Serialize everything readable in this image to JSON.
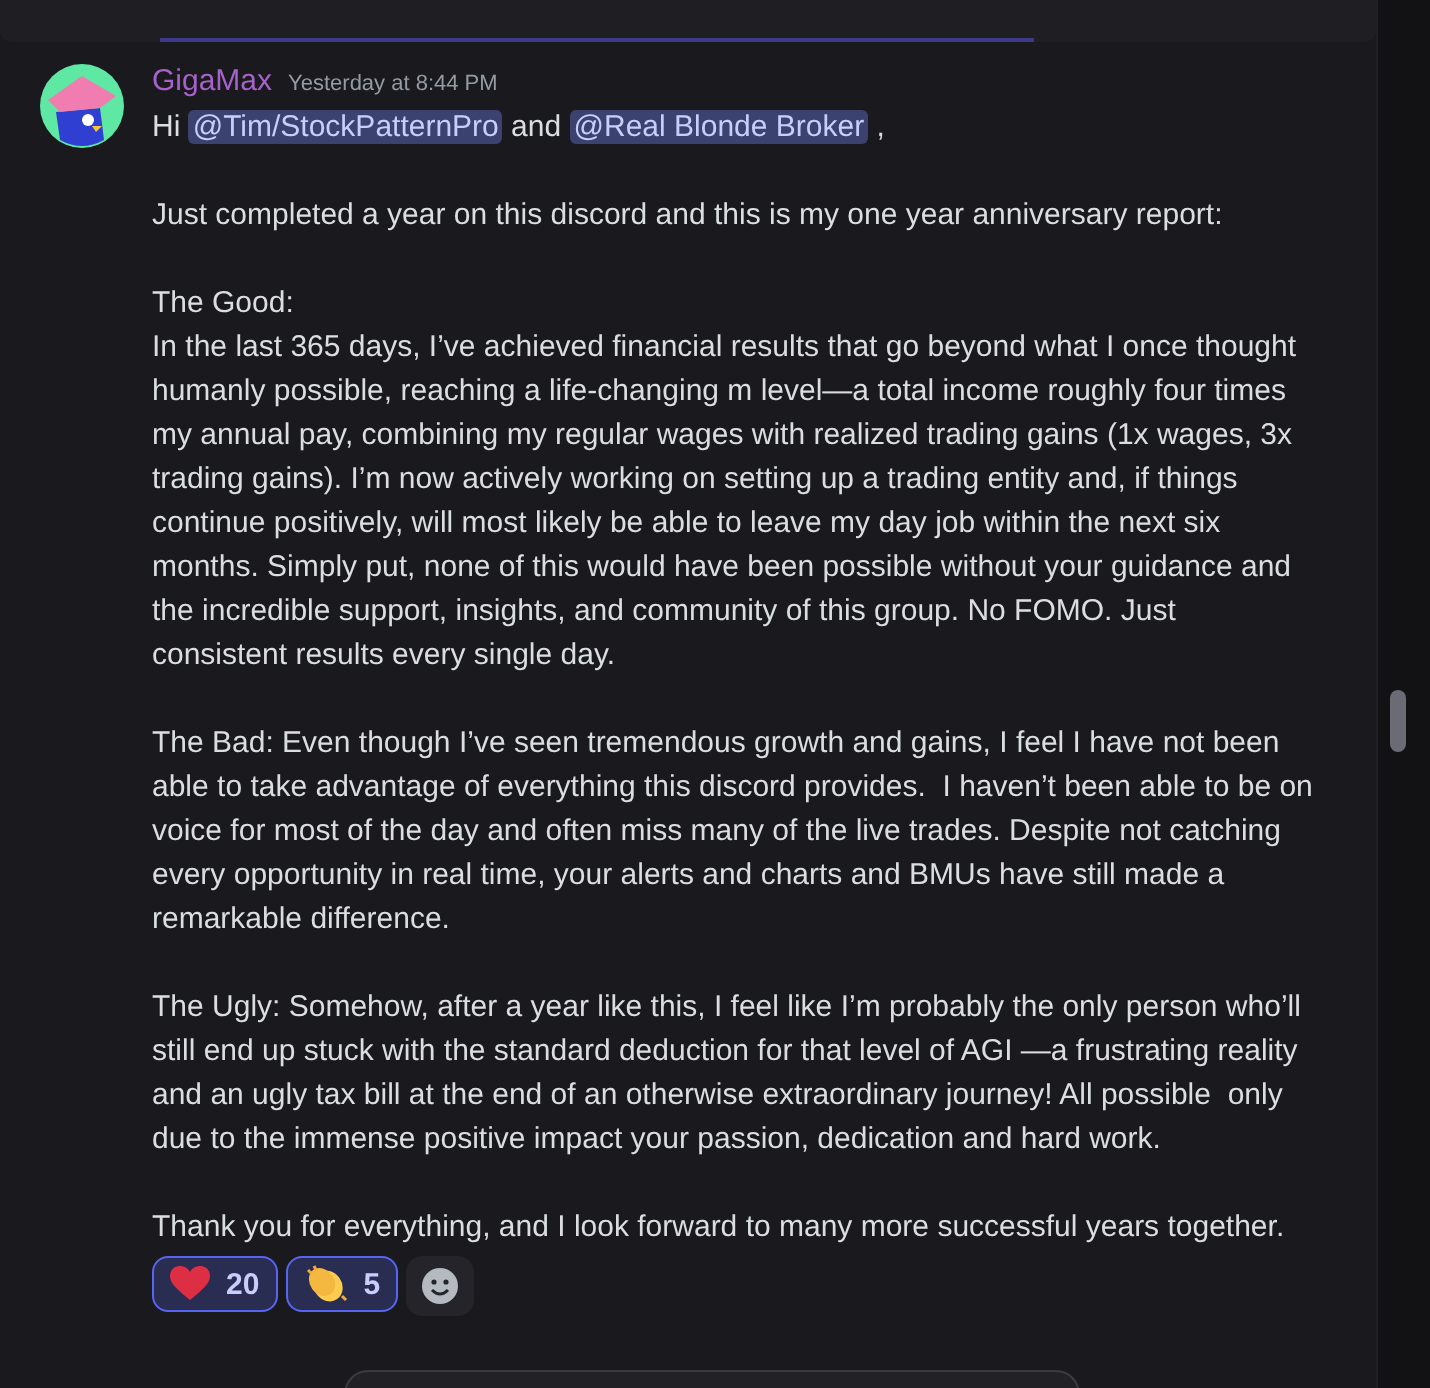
{
  "message": {
    "author": "GigaMax",
    "timestamp": "Yesterday at 8:44 PM",
    "greeting": [
      {
        "kind": "text",
        "text": "Hi "
      },
      {
        "kind": "mention",
        "text": "@Tim/StockPatternPro"
      },
      {
        "kind": "text",
        "text": " and "
      },
      {
        "kind": "mention",
        "text": "@Real Blonde Broker"
      },
      {
        "kind": "text",
        "text": " ,"
      }
    ],
    "paragraphs": [
      [
        "Just completed a year on this discord and this is my one year anniversary report:"
      ],
      [
        "The Good:",
        "In the last 365 days, I’ve achieved financial results that go beyond what I once thought humanly possible, reaching a life-changing m level—a total income roughly four times my annual pay, combining my regular wages with realized trading gains (1x wages, 3x trading gains). I’m now actively working on setting up a trading entity and, if things continue positively, will most likely be able to leave my day job within the next six months. Simply put, none of this would have been possible without your guidance and the incredible support, insights, and community of this group. No FOMO. Just consistent results every single day."
      ],
      [
        "The Bad: Even though I’ve seen tremendous growth and gains, I feel I have not been able to take advantage of everything this discord provides.  I haven’t been able to be on voice for most of the day and often miss many of the live trades. Despite not catching every opportunity in real time, your alerts and charts and BMUs have still made a remarkable difference."
      ],
      [
        "The Ugly: Somehow, after a year like this, I feel like I’m probably the only person who’ll still end up stuck with the standard deduction for that level of AGI —a frustrating reality and an ugly tax bill at the end of an otherwise extraordinary journey! All possible  only due to the immense positive impact your passion, dedication and hard work."
      ],
      [
        "Thank you for everything, and I look forward to many more successful years together."
      ]
    ],
    "reactions": [
      {
        "kind": "heart",
        "count": "20",
        "selected": true
      },
      {
        "kind": "clap",
        "count": "5",
        "selected": true
      }
    ]
  }
}
